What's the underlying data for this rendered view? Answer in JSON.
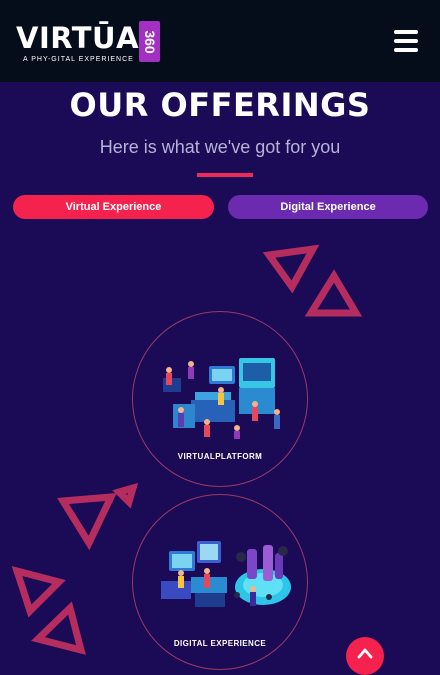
{
  "header": {
    "logo_word": "VIRTŪAL",
    "logo_badge": "360",
    "logo_tagline": "A PHY-GITAL EXPERIENCE",
    "menu_icon": "hamburger-menu-icon"
  },
  "section": {
    "title": "OUR OFFERINGS",
    "subtitle": "Here is what we've got for you"
  },
  "tabs": [
    {
      "label": "Virtual Experience",
      "color": "#f5224e",
      "active": true
    },
    {
      "label": "Digital Experience",
      "color": "#6c2ab0",
      "active": false
    }
  ],
  "offerings": [
    {
      "label": "VIRTUALPLATFORM",
      "illustration": "virtual-platform-illustration"
    },
    {
      "label": "DIGITAL EXPERIENCE",
      "illustration": "digital-experience-illustration"
    }
  ],
  "scroll_top_icon": "chevron-up-icon",
  "colors": {
    "background": "#1b0a55",
    "topbar": "#060d1a",
    "accent": "#f5224e",
    "purple": "#6c2ab0",
    "triangle": "#b52d5e"
  }
}
